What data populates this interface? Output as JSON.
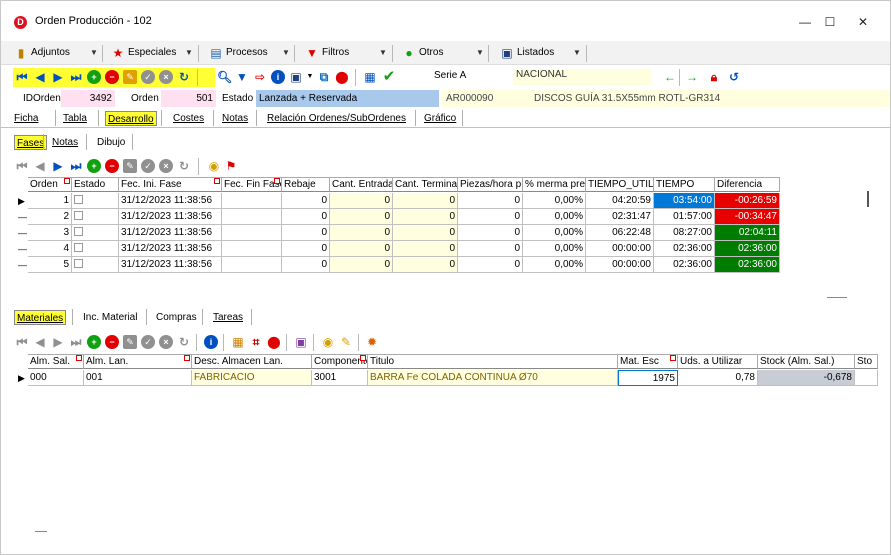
{
  "window": {
    "title": "Orden Producción -  102",
    "app_icon_letter": "D"
  },
  "window_controls": {
    "minimize": "—",
    "maximize": "☐",
    "close": "✕"
  },
  "menu": {
    "adjuntos": "Adjuntos",
    "especiales": "Especiales",
    "procesos": "Procesos",
    "filtros": "Filtros",
    "otros": "Otros",
    "listados": "Listados"
  },
  "navbar": {
    "serie_label": "Serie A",
    "serie_value": "NACIONAL"
  },
  "header": {
    "idorden_label": "IDOrden",
    "idorden_value": "3492",
    "orden_label": "Orden",
    "orden_value": "501",
    "estado_label": "Estado",
    "estado_value": "Lanzada + Reservada",
    "article_code": "AR000090",
    "article_desc": "DISCOS GUÍA 31.5X55mm ROTL-GR314"
  },
  "tabs_main": [
    "Ficha",
    "Tabla",
    "Desarrollo",
    "Costes",
    "Notas",
    "Relación Ordenes/SubOrdenes",
    "Gráfico"
  ],
  "tabs_desarrollo": [
    "Fases",
    "Notas",
    "Dibujo"
  ],
  "fases_grid": {
    "columns": [
      "Orden",
      "Estado",
      "Fec. Ini. Fase",
      "Fec. Fin Fase",
      "Rebaje",
      "Cant. Entrada",
      "Cant. Terminad",
      "Piezas/hora p",
      "% merma prev",
      "TIEMPO_UTIL",
      "TIEMPO",
      "Diferencia"
    ],
    "rows": [
      {
        "orden": "1",
        "fec_ini": "31/12/2023 11:38:56",
        "fec_fin": "",
        "rebaje": "0",
        "cant_entrada": "0",
        "cant_term": "0",
        "piezas": "0",
        "merma": "0,00%",
        "tiempo_util": "04:20:59",
        "tiempo": "03:54:00",
        "diferencia": "-00:26:59"
      },
      {
        "orden": "2",
        "fec_ini": "31/12/2023 11:38:56",
        "fec_fin": "",
        "rebaje": "0",
        "cant_entrada": "0",
        "cant_term": "0",
        "piezas": "0",
        "merma": "0,00%",
        "tiempo_util": "02:31:47",
        "tiempo": "01:57:00",
        "diferencia": "-00:34:47"
      },
      {
        "orden": "3",
        "fec_ini": "31/12/2023 11:38:56",
        "fec_fin": "",
        "rebaje": "0",
        "cant_entrada": "0",
        "cant_term": "0",
        "piezas": "0",
        "merma": "0,00%",
        "tiempo_util": "06:22:48",
        "tiempo": "08:27:00",
        "diferencia": "02:04:11"
      },
      {
        "orden": "4",
        "fec_ini": "31/12/2023 11:38:56",
        "fec_fin": "",
        "rebaje": "0",
        "cant_entrada": "0",
        "cant_term": "0",
        "piezas": "0",
        "merma": "0,00%",
        "tiempo_util": "00:00:00",
        "tiempo": "02:36:00",
        "diferencia": "02:36:00"
      },
      {
        "orden": "5",
        "fec_ini": "31/12/2023 11:38:56",
        "fec_fin": "",
        "rebaje": "0",
        "cant_entrada": "0",
        "cant_term": "0",
        "piezas": "0",
        "merma": "0,00%",
        "tiempo_util": "00:00:00",
        "tiempo": "02:36:00",
        "diferencia": "02:36:00"
      }
    ]
  },
  "tabs_lower": [
    "Materiales",
    "Inc. Material",
    "Compras",
    "Tareas"
  ],
  "materiales_grid": {
    "columns": [
      "Alm. Sal.",
      "Alm. Lan.",
      "Desc. Almacen Lan.",
      "Componente",
      "Titulo",
      "Mat. Esc",
      "Uds. a Utilizar",
      "Stock (Alm. Sal.)",
      "Sto"
    ],
    "rows": [
      {
        "alm_sal": "000",
        "alm_lan": "001",
        "desc": "FABRICACIO",
        "componente": "3001",
        "titulo": "BARRA Fe COLADA CONTINUA Ø70",
        "mat_esc": "1975",
        "uds": "0,78",
        "stock": "-0,678",
        "sto": ""
      }
    ]
  },
  "colors": {
    "highlight": "#ffff33",
    "red": "#e80000",
    "green": "#007c00",
    "blue": "#0078d7"
  }
}
